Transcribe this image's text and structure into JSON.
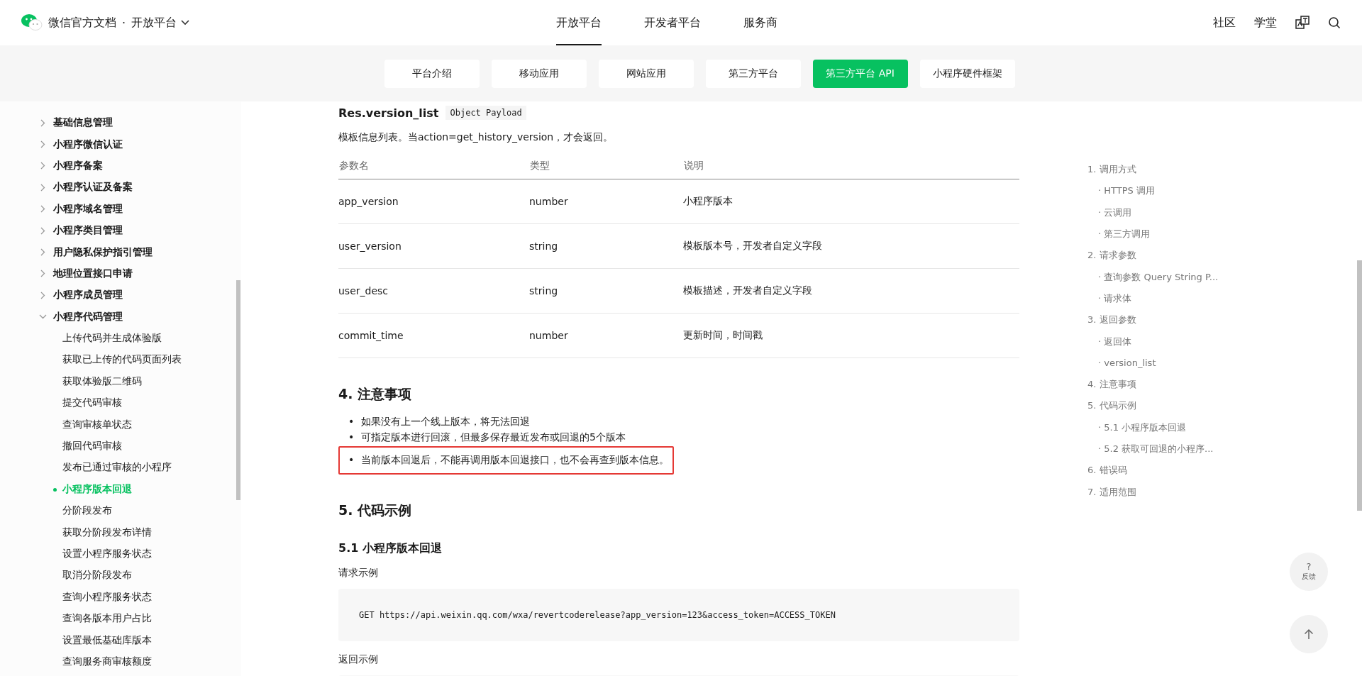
{
  "header": {
    "site_title": "微信官方文档",
    "separator": "·",
    "platform": "开放平台",
    "nav": [
      {
        "label": "开放平台",
        "selected": true
      },
      {
        "label": "开发者平台",
        "selected": false
      },
      {
        "label": "服务商",
        "selected": false
      }
    ],
    "links": [
      "社区",
      "学堂"
    ]
  },
  "subnav": [
    {
      "label": "平台介绍",
      "selected": false
    },
    {
      "label": "移动应用",
      "selected": false
    },
    {
      "label": "网站应用",
      "selected": false
    },
    {
      "label": "第三方平台",
      "selected": false
    },
    {
      "label": "第三方平台 API",
      "selected": true
    },
    {
      "label": "小程序硬件框架",
      "selected": false
    }
  ],
  "sidebar": {
    "items": [
      {
        "label": "基础信息管理",
        "expanded": false
      },
      {
        "label": "小程序微信认证",
        "expanded": false
      },
      {
        "label": "小程序备案",
        "expanded": false
      },
      {
        "label": "小程序认证及备案",
        "expanded": false
      },
      {
        "label": "小程序域名管理",
        "expanded": false
      },
      {
        "label": "小程序类目管理",
        "expanded": false
      },
      {
        "label": "用户隐私保护指引管理",
        "expanded": false
      },
      {
        "label": "地理位置接口申请",
        "expanded": false
      },
      {
        "label": "小程序成员管理",
        "expanded": false
      },
      {
        "label": "小程序代码管理",
        "expanded": true,
        "children": [
          {
            "label": "上传代码并生成体验版",
            "selected": false
          },
          {
            "label": "获取已上传的代码页面列表",
            "selected": false
          },
          {
            "label": "获取体验版二维码",
            "selected": false
          },
          {
            "label": "提交代码审核",
            "selected": false
          },
          {
            "label": "查询审核单状态",
            "selected": false
          },
          {
            "label": "撤回代码审核",
            "selected": false
          },
          {
            "label": "发布已通过审核的小程序",
            "selected": false
          },
          {
            "label": "小程序版本回退",
            "selected": true
          },
          {
            "label": "分阶段发布",
            "selected": false
          },
          {
            "label": "获取分阶段发布详情",
            "selected": false
          },
          {
            "label": "设置小程序服务状态",
            "selected": false
          },
          {
            "label": "取消分阶段发布",
            "selected": false
          },
          {
            "label": "查询小程序服务状态",
            "selected": false
          },
          {
            "label": "查询各版本用户占比",
            "selected": false
          },
          {
            "label": "设置最低基础库版本",
            "selected": false
          },
          {
            "label": "查询服务商审核额度",
            "selected": false
          }
        ]
      }
    ]
  },
  "doc": {
    "field_name": "Res.version_list",
    "field_type": "Object Payload",
    "description": "模板信息列表。当action=get_history_version，才会返回。",
    "table": {
      "columns": [
        "参数名",
        "类型",
        "说明"
      ],
      "rows": [
        [
          "app_version",
          "number",
          "小程序版本"
        ],
        [
          "user_version",
          "string",
          "模板版本号，开发者自定义字段"
        ],
        [
          "user_desc",
          "string",
          "模板描述，开发者自定义字段"
        ],
        [
          "commit_time",
          "number",
          "更新时间，时间戳"
        ]
      ]
    },
    "notes_heading": "4. 注意事项",
    "notes": [
      {
        "bullet": "•",
        "text": "如果没有上一个线上版本，将无法回退",
        "highlighted": false
      },
      {
        "bullet": "•",
        "text": "可指定版本进行回滚，但最多保存最近发布或回退的5个版本",
        "highlighted": false
      },
      {
        "bullet": "•",
        "text": "当前版本回退后，不能再调用版本回退接口，也不会再查到版本信息。",
        "highlighted": true
      }
    ],
    "examples_heading": "5. 代码示例",
    "example_heading": "5.1 小程序版本回退",
    "request_label": "请求示例",
    "request_code": "GET https://api.weixin.qq.com/wxa/revertcoderelease?app_version=123&access_token=ACCESS_TOKEN",
    "response_label": "返回示例"
  },
  "toc": [
    {
      "label": "1. 调用方式",
      "children": [
        {
          "label": "· HTTPS 调用"
        },
        {
          "label": "· 云调用"
        },
        {
          "label": "· 第三方调用"
        }
      ]
    },
    {
      "label": "2. 请求参数",
      "children": [
        {
          "label": "· 查询参数 Query String P..."
        },
        {
          "label": "· 请求体"
        }
      ]
    },
    {
      "label": "3. 返回参数",
      "children": [
        {
          "label": "· 返回体"
        },
        {
          "label": "· version_list"
        }
      ]
    },
    {
      "label": "4. 注意事项"
    },
    {
      "label": "5. 代码示例",
      "children": [
        {
          "label": "· 5.1 小程序版本回退"
        },
        {
          "label": "· 5.2 获取可回退的小程序..."
        }
      ]
    },
    {
      "label": "6. 错误码"
    },
    {
      "label": "7. 适用范围"
    }
  ],
  "float": {
    "feedback_icon": "?",
    "feedback_label": "反馈"
  }
}
